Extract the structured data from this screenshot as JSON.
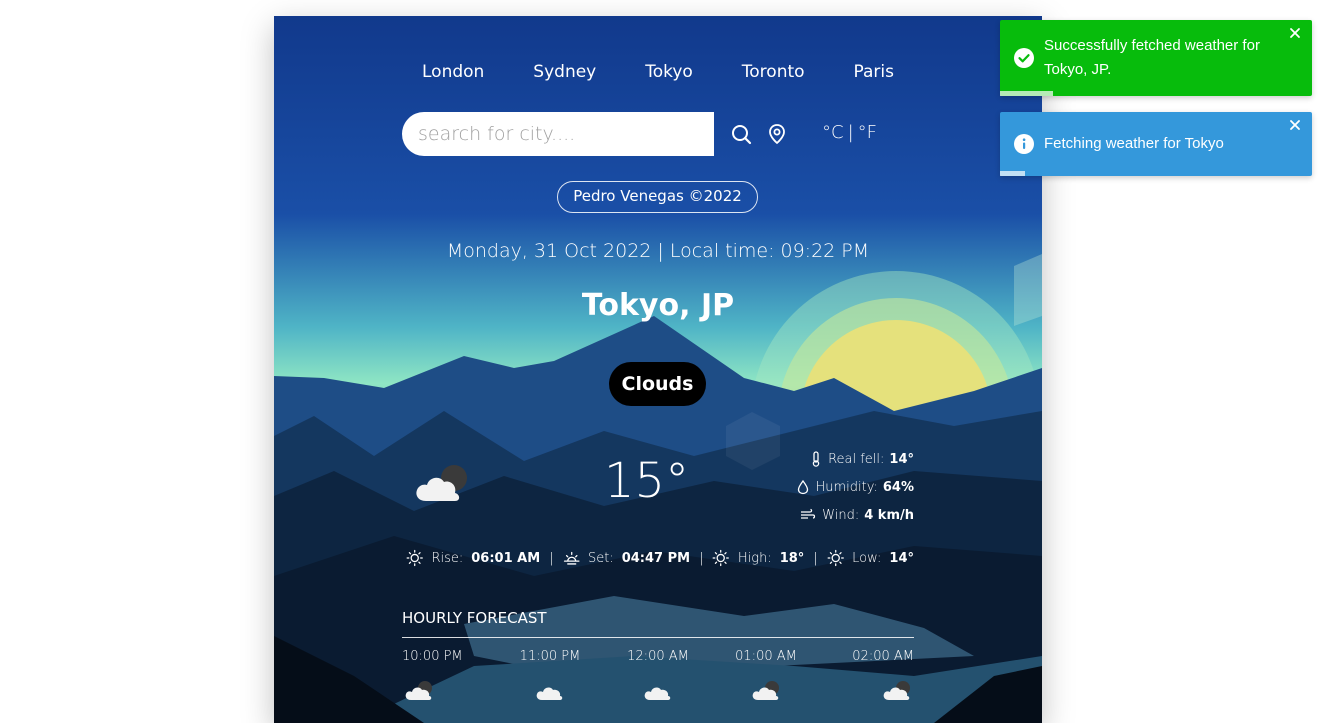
{
  "cities": [
    "London",
    "Sydney",
    "Tokyo",
    "Toronto",
    "Paris"
  ],
  "search": {
    "placeholder": "search for city...."
  },
  "units": {
    "celsius": "°C",
    "separator": "|",
    "fahrenheit": "°F"
  },
  "credit": "Pedro Venegas ©2022",
  "datetime": "Monday, 31 Oct 2022 | Local time: 09:22 PM",
  "location": "Tokyo, JP",
  "condition": "Clouds",
  "temperature": "15°",
  "details": {
    "real_feel": {
      "label": "Real fell:",
      "value": "14°"
    },
    "humidity": {
      "label": "Humidity:",
      "value": "64%"
    },
    "wind": {
      "label": "Wind:",
      "value": "4 km/h"
    }
  },
  "sun": {
    "rise": {
      "label": "Rise:",
      "value": "06:01 AM"
    },
    "set": {
      "label": "Set:",
      "value": "04:47 PM"
    },
    "high": {
      "label": "High:",
      "value": "18°"
    },
    "low": {
      "label": "Low:",
      "value": "14°"
    },
    "separator": "|"
  },
  "hourly": {
    "title": "HOURLY FORECAST",
    "items": [
      {
        "time": "10:00 PM",
        "icon": "cloud-moon-icon"
      },
      {
        "time": "11:00 PM",
        "icon": "cloud-icon"
      },
      {
        "time": "12:00 AM",
        "icon": "cloud-icon"
      },
      {
        "time": "01:00 AM",
        "icon": "cloud-moon-icon"
      },
      {
        "time": "02:00 AM",
        "icon": "cloud-moon-icon"
      }
    ]
  },
  "toasts": [
    {
      "type": "success",
      "message": "Successfully fetched weather for Tokyo, JP.",
      "icon": "check-circle-icon",
      "color": "#07bc0c",
      "progress": 0.17
    },
    {
      "type": "info",
      "message": "Fetching weather for Tokyo",
      "icon": "info-circle-icon",
      "color": "#3498db",
      "progress": 0.08
    }
  ],
  "colors": {
    "sky_top": "#133a8e",
    "sky_glow": "#8fe6c4",
    "sun": "#e8e07a",
    "mountains": "#0f2a4a",
    "condition_bg": "#000000"
  }
}
